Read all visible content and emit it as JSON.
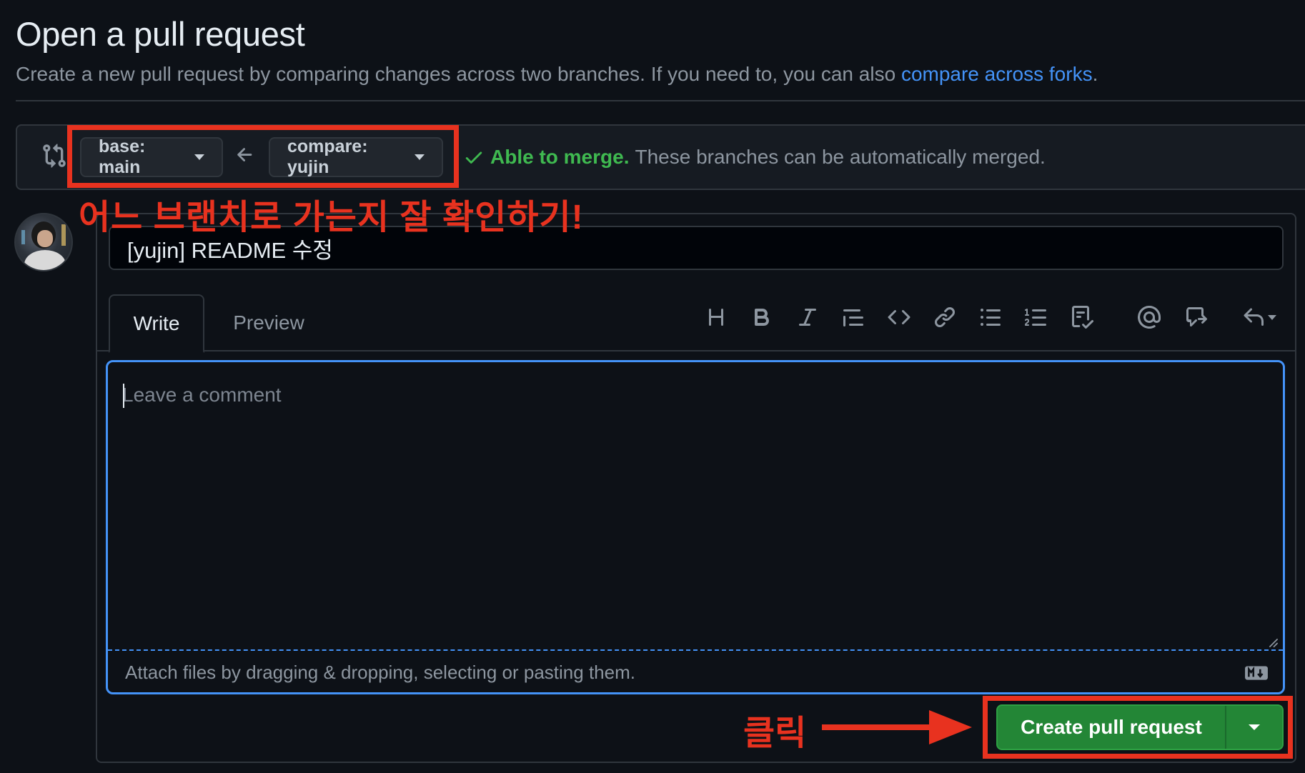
{
  "page": {
    "title": "Open a pull request",
    "subtitle_prefix": "Create a new pull request by comparing changes across two branches. If you need to, you can also ",
    "subtitle_link": "compare across forks",
    "subtitle_suffix": "."
  },
  "range": {
    "base_label": "base: main",
    "compare_label": "compare: yujin",
    "merge_ok": "Able to merge.",
    "merge_desc": "These branches can be automatically merged."
  },
  "annotations": {
    "branch_note": "어느 브랜치로 가는지 잘 확인하기!",
    "click_note": "클릭",
    "color": "#e8321f"
  },
  "form": {
    "title_value": "[yujin] README 수정",
    "tabs": [
      "Write",
      "Preview"
    ],
    "toolbar_icons": [
      "heading-icon",
      "bold-icon",
      "italic-icon",
      "quote-icon",
      "code-icon",
      "link-icon",
      "unordered-list-icon",
      "ordered-list-icon",
      "task-list-icon",
      "mention-icon",
      "cross-reference-icon",
      "saved-replies-icon"
    ],
    "comment_placeholder": "Leave a comment",
    "attach_text": "Attach files by dragging & dropping, selecting or pasting them.",
    "submit_label": "Create pull request"
  },
  "colors": {
    "background": "#0d1117",
    "accent": "#4493f8",
    "success": "#3fb950",
    "button_green": "#238636"
  }
}
